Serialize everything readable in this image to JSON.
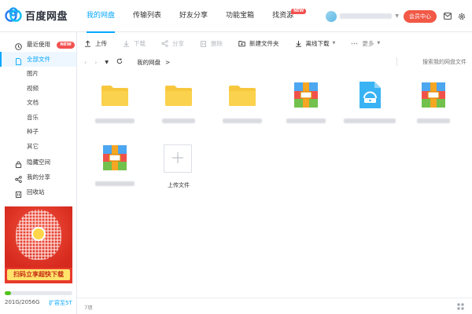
{
  "app": {
    "logo_text": "百度网盘"
  },
  "nav": {
    "items": [
      {
        "label": "我的网盘",
        "active": true
      },
      {
        "label": "传输列表",
        "active": false
      },
      {
        "label": "好友分享",
        "active": false
      },
      {
        "label": "功能宝箱",
        "active": false
      },
      {
        "label": "找资源",
        "active": false,
        "badge": "NEW"
      }
    ]
  },
  "user": {
    "vip_button": "会员中心",
    "icons": [
      "mail-icon",
      "gear-icon"
    ]
  },
  "sidebar": {
    "recent": {
      "label": "最近使用",
      "badge": "NEW"
    },
    "all_files": {
      "label": "全部文件"
    },
    "categories": [
      "图片",
      "视频",
      "文档",
      "音乐",
      "种子",
      "其它"
    ],
    "hidden_space": {
      "label": "隐藏空间"
    },
    "my_share": {
      "label": "我的分享"
    },
    "recycle": {
      "label": "回收站"
    },
    "promo_banner": "扫码立享超快下载",
    "storage": {
      "text": "201G/2056G",
      "used_fraction": 0.098,
      "expand_link": "扩容至5T"
    }
  },
  "toolbar": {
    "upload": "上传",
    "download": "下载",
    "share": "分享",
    "delete": "删除",
    "new_folder": "新建文件夹",
    "offline_download": "离线下载",
    "more": "更多"
  },
  "path": {
    "crumbs": [
      "我的网盘"
    ],
    "separator": ">",
    "search_placeholder": "搜索我的网盘文件"
  },
  "files": [
    {
      "type": "folder"
    },
    {
      "type": "folder"
    },
    {
      "type": "folder"
    },
    {
      "type": "archive"
    },
    {
      "type": "disk-image"
    },
    {
      "type": "archive"
    },
    {
      "type": "archive"
    }
  ],
  "upload_tile": {
    "label": "上传文件"
  },
  "status": {
    "count": "7项"
  },
  "colors": {
    "accent": "#06a7ff",
    "vip": "#f15846",
    "badge": "#f35151",
    "folder": "#f7c73e",
    "storage_fill": "#52c41a"
  }
}
